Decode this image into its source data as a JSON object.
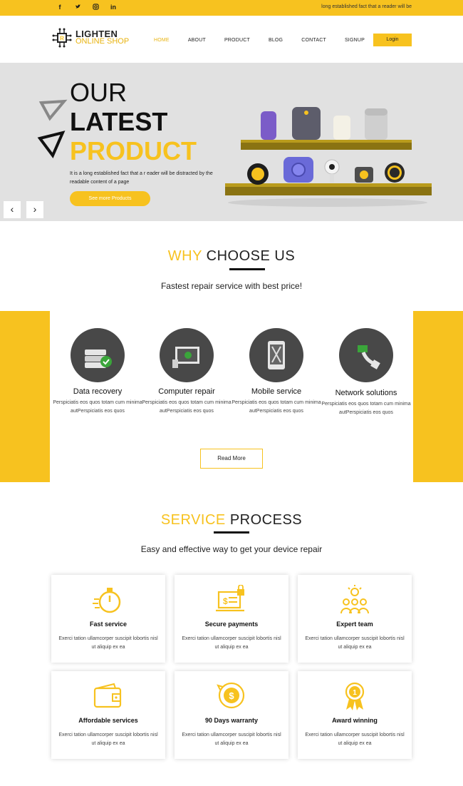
{
  "topbar": {
    "social": [
      "f",
      "t",
      "ig",
      "in"
    ],
    "tagline": "long established fact that a reader will be"
  },
  "brand": {
    "line1": "LIGHTEN",
    "line2": "ONLINE SHOP"
  },
  "nav": [
    "HOME",
    "ABOUT",
    "PRODUCT",
    "BLOG",
    "CONTACT",
    "SIGNUP"
  ],
  "login_label": "Login",
  "hero": {
    "line1": "OUR",
    "line2": "LATEST",
    "line3": "PRODUCT",
    "desc": "It is a long established fact that a r eader will be distracted by the readable content of a page",
    "cta": "See more Products",
    "prev": "‹",
    "next": "›"
  },
  "why": {
    "title_yellow": "WHY",
    "title_dark": "CHOOSE US",
    "subtitle": "Fastest repair service with best price!",
    "services": [
      {
        "name": "Data recovery",
        "text": "Perspiciatis eos quos totam cum minima autPerspiciatis eos quos"
      },
      {
        "name": "Computer repair",
        "text": "Perspiciatis eos quos totam cum minima autPerspiciatis eos quos"
      },
      {
        "name": "Mobile service",
        "text": "Perspiciatis eos quos totam cum minima autPerspiciatis eos quos"
      },
      {
        "name": "Network solutions",
        "text": "Perspiciatis eos quos totam cum minima autPerspiciatis eos quos"
      }
    ],
    "read_more": "Read More"
  },
  "process": {
    "title_yellow": "SERVICE",
    "title_dark": "PROCESS",
    "subtitle": "Easy and effective way to get your device repair",
    "cards": [
      {
        "title": "Fast service",
        "text": "Exerci tation ullamcorper suscipit lobortis nisl ut aliquip ex ea",
        "icon": "stopwatch-icon"
      },
      {
        "title": "Secure payments",
        "text": "Exerci tation ullamcorper suscipit lobortis nisl ut aliquip ex ea",
        "icon": "secure-payment-icon"
      },
      {
        "title": "Expert team",
        "text": "Exerci tation ullamcorper suscipit lobortis nisl ut aliquip ex ea",
        "icon": "team-idea-icon"
      },
      {
        "title": "Affordable services",
        "text": "Exerci tation ullamcorper suscipit lobortis nisl ut aliquip ex ea",
        "icon": "wallet-icon"
      },
      {
        "title": "90 Days warranty",
        "text": "Exerci tation ullamcorper suscipit lobortis nisl ut aliquip ex ea",
        "icon": "warranty-coin-icon"
      },
      {
        "title": "Award winning",
        "text": "Exerci tation ullamcorper suscipit lobortis nisl ut aliquip ex ea",
        "icon": "award-medal-icon"
      }
    ]
  },
  "colors": {
    "accent": "#f7c21f",
    "dark": "#222222",
    "hero_bg": "#e1e1e1",
    "icon_circle": "#484848"
  }
}
